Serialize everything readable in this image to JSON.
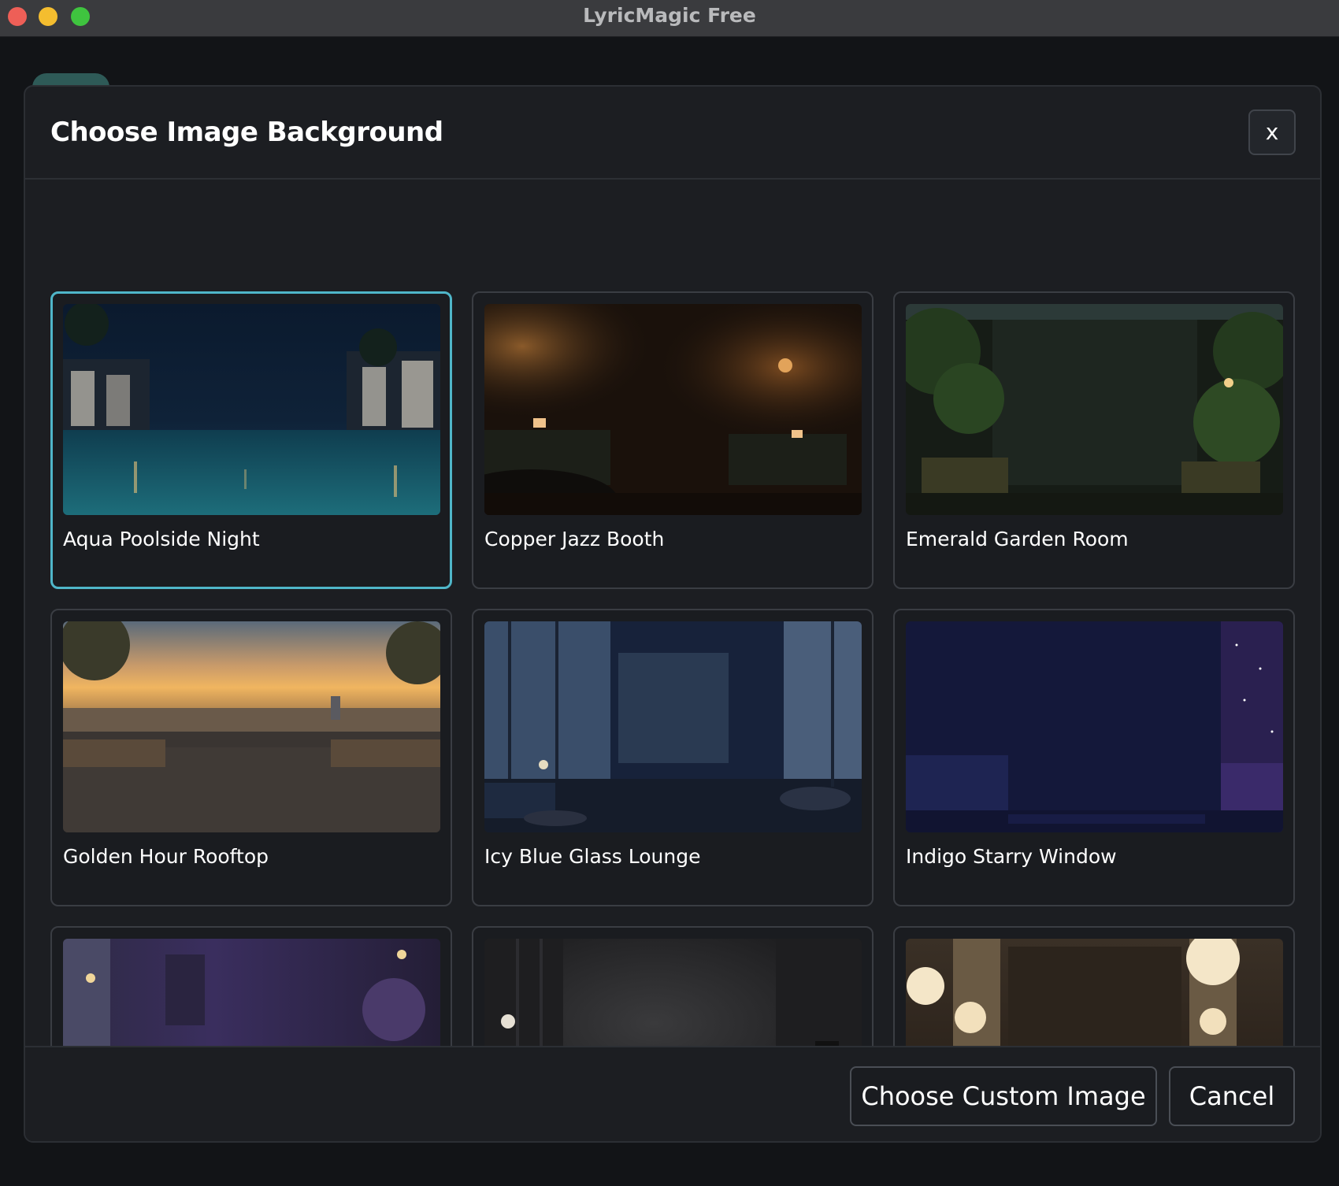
{
  "window": {
    "title": "LyricMagic Free"
  },
  "dialog": {
    "title": "Choose Image Background",
    "close_label": "x"
  },
  "backgrounds": [
    {
      "label": "Aqua Poolside Night",
      "selected": true
    },
    {
      "label": "Copper Jazz Booth",
      "selected": false
    },
    {
      "label": "Emerald Garden Room",
      "selected": false
    },
    {
      "label": "Golden Hour Rooftop",
      "selected": false
    },
    {
      "label": "Icy Blue Glass Lounge",
      "selected": false
    },
    {
      "label": "Indigo Starry Window",
      "selected": false
    },
    {
      "label": "",
      "selected": false
    },
    {
      "label": "",
      "selected": false
    },
    {
      "label": "",
      "selected": false
    }
  ],
  "footer": {
    "custom_label": "Choose Custom Image",
    "cancel_label": "Cancel"
  },
  "colors": {
    "selection_accent": "#4fb6c9",
    "dialog_bg": "#1c1e22"
  }
}
